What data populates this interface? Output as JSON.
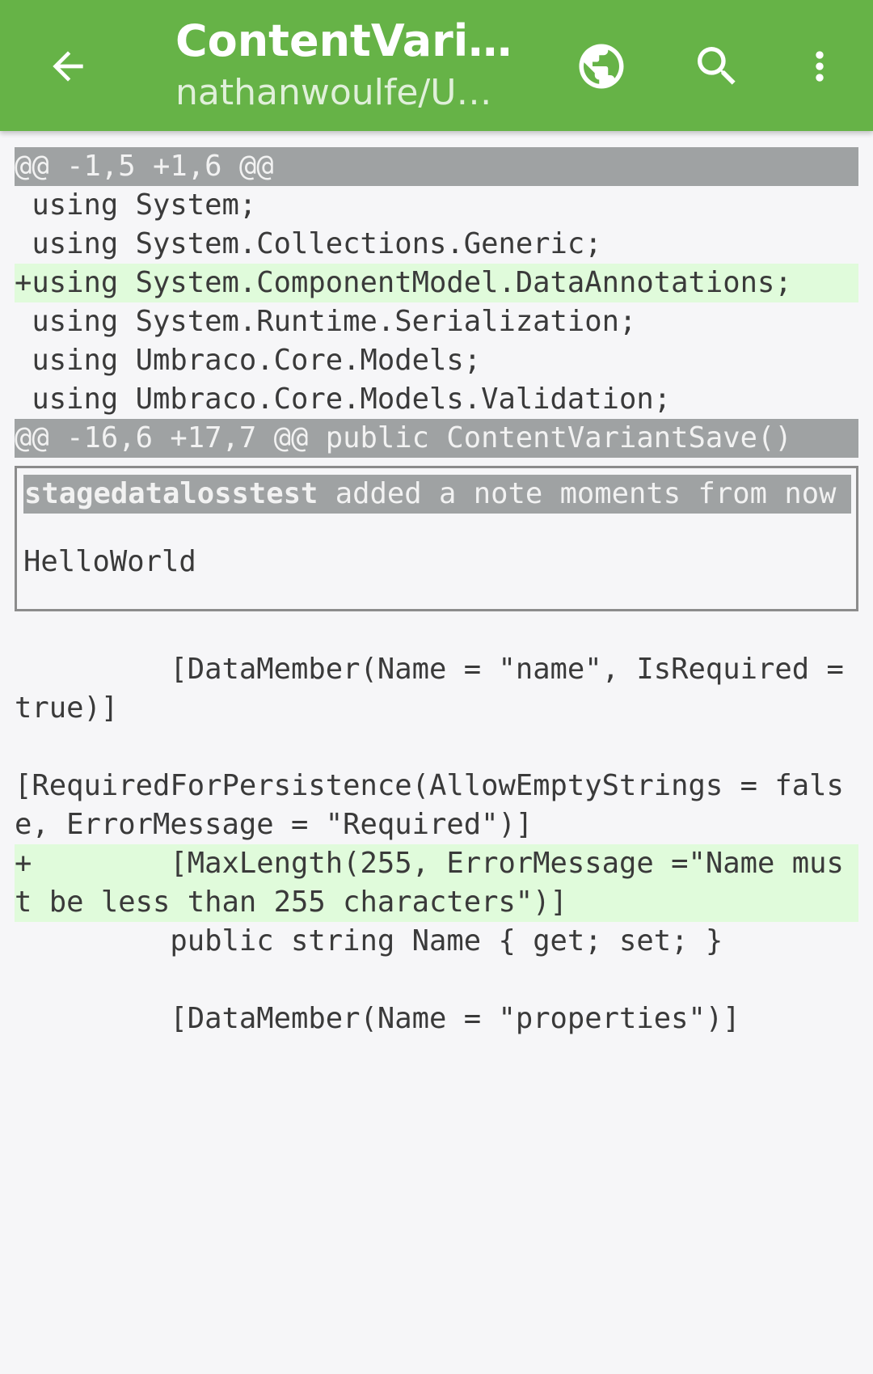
{
  "appbar": {
    "title": "ContentVariantSave.cs",
    "subtitle": "nathanwoulfe/Umbraco-CMS",
    "icons": {
      "back": "arrow-back-icon",
      "browser": "globe-icon",
      "search": "search-icon",
      "overflow": "more-vert-icon"
    },
    "color": "#66b347"
  },
  "diff": {
    "lines1": [
      {
        "type": "hunk",
        "text": "@@ -1,5 +1,6 @@"
      },
      {
        "type": "context",
        "text": " using System;"
      },
      {
        "type": "context",
        "text": " using System.Collections.Generic;"
      },
      {
        "type": "added",
        "text": "+using System.ComponentModel.DataAnnotations;"
      },
      {
        "type": "context",
        "text": " using System.Runtime.Serialization;"
      },
      {
        "type": "context",
        "text": " using Umbraco.Core.Models;"
      },
      {
        "type": "context",
        "text": " using Umbraco.Core.Models.Validation;"
      },
      {
        "type": "hunk",
        "text": "@@ -16,6 +17,7 @@ public ContentVariantSave()"
      }
    ],
    "note": {
      "author": "stagedatalosstest",
      "action": " added a note moments from now",
      "body": "HelloWorld"
    },
    "lines2": [
      {
        "type": "context",
        "text": "         [DataMember(Name = \"name\", IsRequired = true)]"
      },
      {
        "type": "context",
        "text": ""
      },
      {
        "type": "context",
        "text": "[RequiredForPersistence(AllowEmptyStrings = false, ErrorMessage = \"Required\")]"
      },
      {
        "type": "added",
        "text": "+        [MaxLength(255, ErrorMessage =\"Name must be less than 255 characters\")]"
      },
      {
        "type": "context",
        "text": "         public string Name { get; set; }"
      },
      {
        "type": "context",
        "text": ""
      },
      {
        "type": "context",
        "text": "         [DataMember(Name = \"properties\")]"
      }
    ],
    "colors": {
      "hunk_bg": "#9fa2a3",
      "added_bg": "#e0fbdb",
      "background": "#f6f6f8"
    }
  }
}
